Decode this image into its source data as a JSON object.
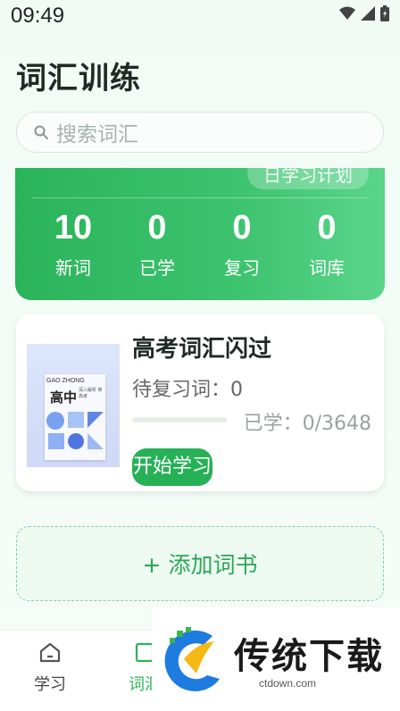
{
  "status_bar": {
    "time": "09:49"
  },
  "header": {
    "title": "词汇训练"
  },
  "search": {
    "placeholder": "搜索词汇"
  },
  "stats": {
    "plan_label": "日学习计划",
    "items": [
      {
        "value": "10",
        "label": "新词"
      },
      {
        "value": "0",
        "label": "已学"
      },
      {
        "value": "0",
        "label": "复习"
      },
      {
        "value": "0",
        "label": "词库"
      }
    ]
  },
  "book": {
    "title": "高考词汇闪过",
    "review_text": "待复习词：0",
    "learned_text": "已学：0/3648",
    "progress_fraction": 0,
    "start_label": "开始学习",
    "cover": {
      "en_title": "GAO ZHONG",
      "zh_title": "高中",
      "subtitle": "深入解析 新高考"
    }
  },
  "add_book": {
    "label": "+ 添加词书"
  },
  "bottom_nav": [
    {
      "label": "学习",
      "icon": "home-icon"
    },
    {
      "label": "词汇",
      "icon": "book-icon"
    }
  ],
  "watermark": {
    "text": "传统下载",
    "url": "ctdown.com"
  },
  "colors": {
    "accent": "#2bb35a",
    "accent_light": "#5ad58b",
    "background": "#f1fbf4"
  }
}
